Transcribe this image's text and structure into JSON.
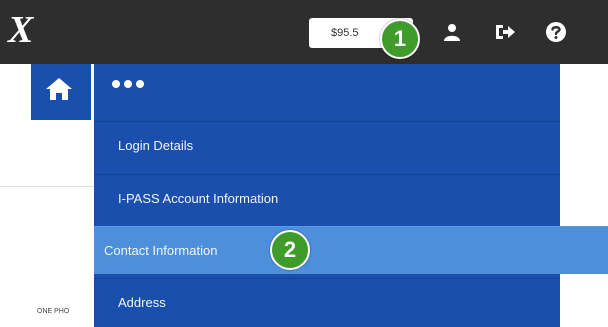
{
  "header": {
    "logo_text": "X",
    "balance": "$95.5",
    "icons": [
      "user-icon",
      "sign-out-icon",
      "help-icon"
    ]
  },
  "badges": [
    "1",
    "2"
  ],
  "nav": {
    "home_icon": "home-icon",
    "more_icon": "more-dots-icon"
  },
  "menu": {
    "items": [
      {
        "label": "Login Details"
      },
      {
        "label": "I-PASS Account Information"
      },
      {
        "label": "Contact Information",
        "active": true
      },
      {
        "label": "Address"
      }
    ]
  },
  "page": {
    "partial_text": "ONE PHO"
  },
  "colors": {
    "topbar": "#2e2e2e",
    "menu_bg": "#1b4fae",
    "menu_active": "#4d8fdb",
    "badge": "#3f9b2a"
  }
}
